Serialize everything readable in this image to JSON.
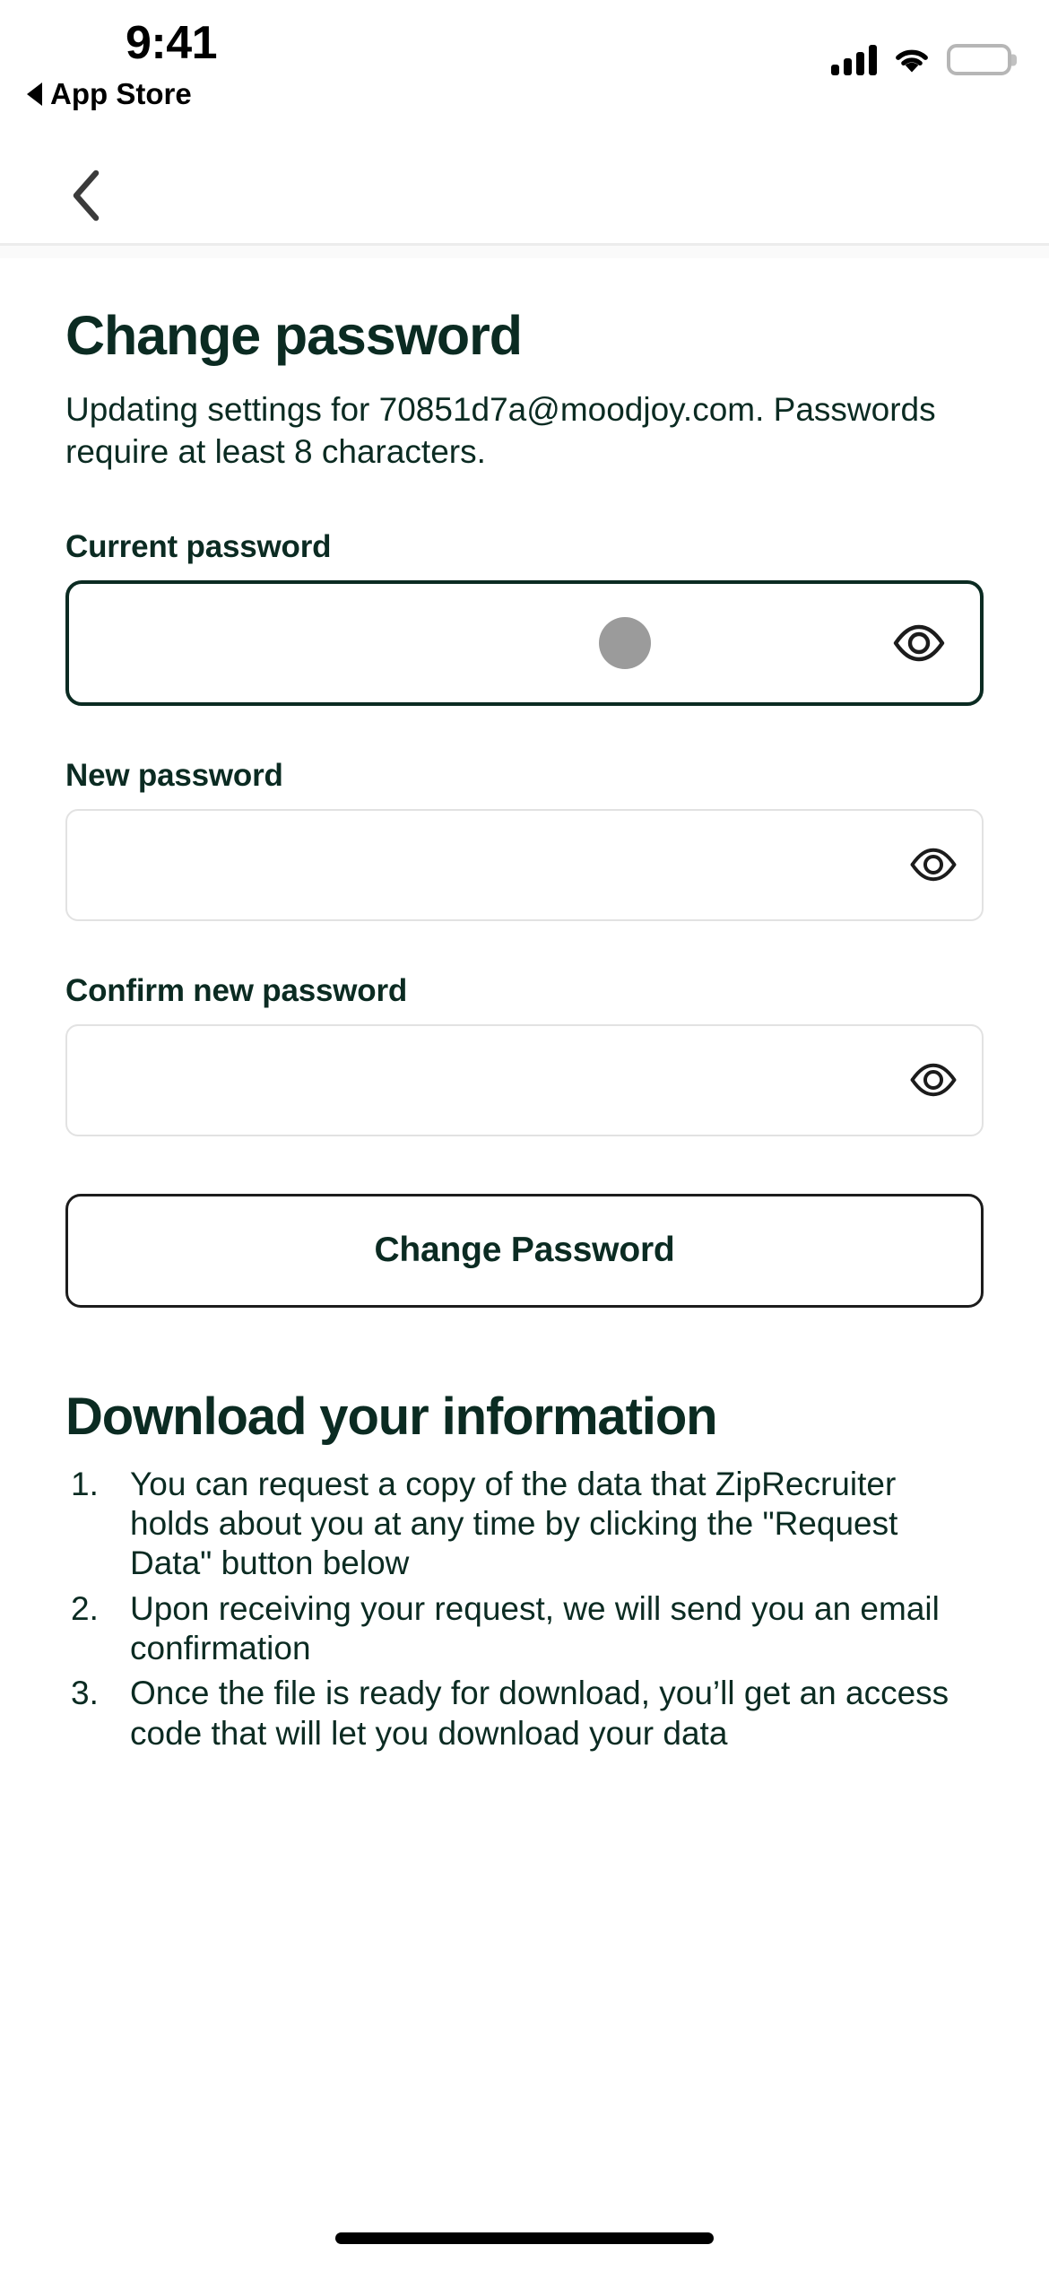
{
  "status_bar": {
    "time": "9:41",
    "back_app_label": "App Store",
    "cellular_icon": "cellular-signal-icon",
    "wifi_icon": "wifi-icon",
    "battery_icon": "battery-full-icon"
  },
  "nav": {
    "back_icon": "chevron-left-icon"
  },
  "page": {
    "title": "Change password",
    "description": "Updating settings for 70851d7a@moodjoy.com. Passwords require at least 8 characters."
  },
  "form": {
    "current_password": {
      "label": "Current password",
      "value": "",
      "placeholder": "",
      "focused": true,
      "toggle_icon": "eye-icon"
    },
    "new_password": {
      "label": "New password",
      "value": "",
      "placeholder": "",
      "focused": false,
      "toggle_icon": "eye-icon"
    },
    "confirm_password": {
      "label": "Confirm new password",
      "value": "",
      "placeholder": "",
      "focused": false,
      "toggle_icon": "eye-icon"
    },
    "submit_label": "Change Password"
  },
  "download_section": {
    "title": "Download your information",
    "steps": [
      "You can request a copy of the data that ZipRecruiter holds about you at any time by clicking the \"Request Data\" button below",
      "Upon receiving your request, we will send you an email confirmation",
      "Once the file is ready for download, you’ll get an access code that will let you download your data"
    ]
  },
  "colors": {
    "brand_dark_green": "#0B2B22",
    "field_border": "#E2E2E2",
    "tap_indicator": "#9B9B9B",
    "button_border": "#1C1C1C"
  }
}
